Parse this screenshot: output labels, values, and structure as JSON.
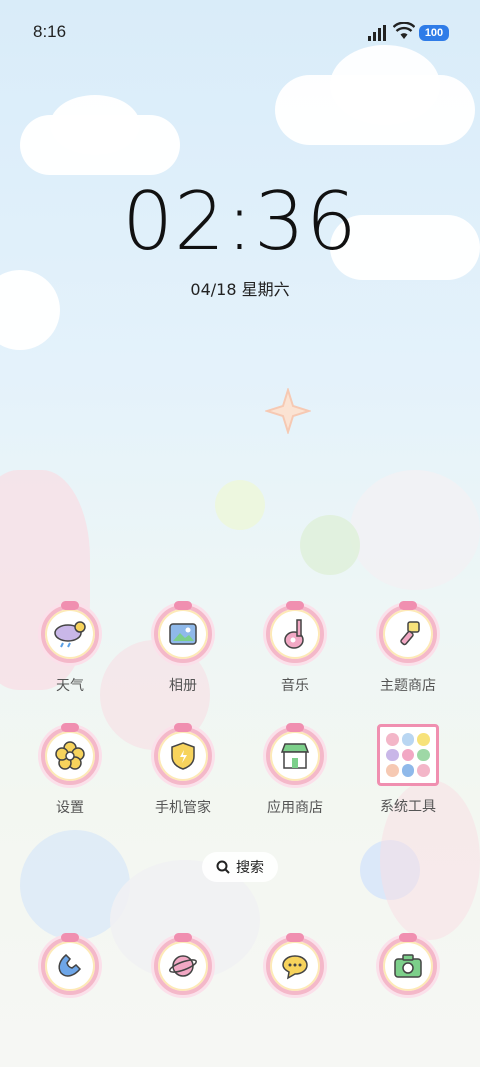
{
  "status_bar": {
    "time": "8:16",
    "battery": "100"
  },
  "lockscreen": {
    "clock": "02:36",
    "date": "04/18 星期六"
  },
  "apps": [
    {
      "label": "天气",
      "icon": "weather-icon"
    },
    {
      "label": "相册",
      "icon": "gallery-icon"
    },
    {
      "label": "音乐",
      "icon": "music-icon"
    },
    {
      "label": "主题商店",
      "icon": "themes-icon"
    },
    {
      "label": "设置",
      "icon": "settings-icon"
    },
    {
      "label": "手机管家",
      "icon": "security-icon"
    },
    {
      "label": "应用商店",
      "icon": "app-store-icon"
    },
    {
      "label": "系统工具",
      "icon": "system-tools-folder-icon"
    }
  ],
  "search": {
    "label": "搜索"
  },
  "dock": [
    {
      "icon": "phone-icon"
    },
    {
      "icon": "browser-icon"
    },
    {
      "icon": "messages-icon"
    },
    {
      "icon": "camera-icon"
    }
  ],
  "colors": {
    "accent_pink": "#f08fb0",
    "battery_blue": "#2f7ce8"
  }
}
